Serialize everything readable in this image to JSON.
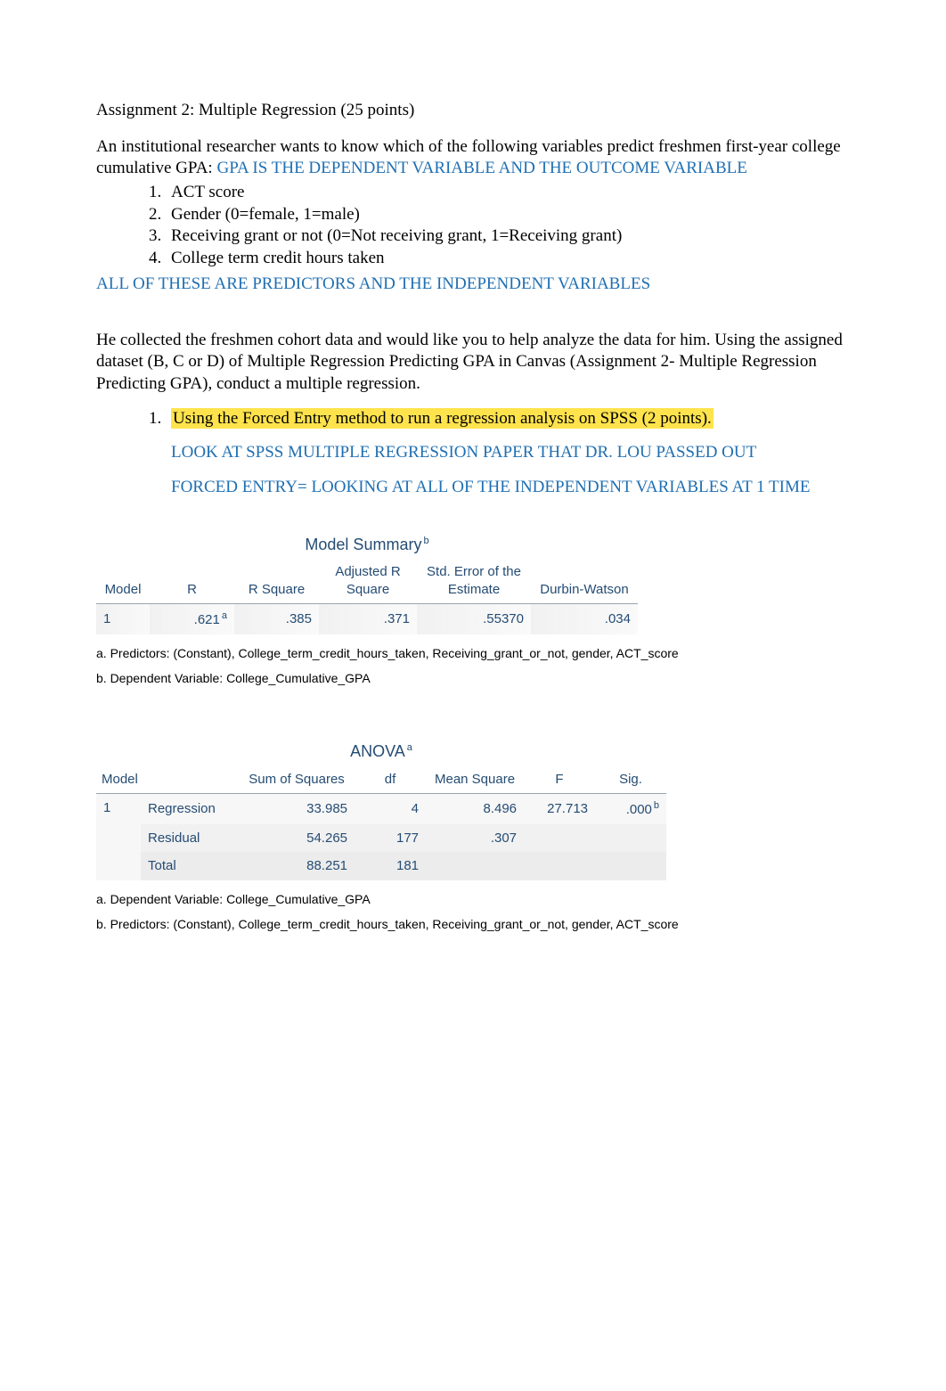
{
  "header": {
    "title": "Assignment 2: Multiple Regression (25 points)"
  },
  "intro": {
    "line1": "An institutional researcher wants to know which of the following variables predict freshmen first-year college cumulative GPA:  ",
    "dep_note": "GPA IS THE DEPENDENT VARIABLE AND THE OUTCOME VARIABLE",
    "items": {
      "i1": "ACT score",
      "i2": "Gender (0=female, 1=male)",
      "i3": "Receiving grant or not (0=Not receiving grant, 1=Receiving grant)",
      "i4": "College term credit hours taken"
    },
    "all_predictors": "ALL OF THESE ARE PREDICTORS AND THE INDEPENDENT VARIABLES"
  },
  "collected": "He collected the freshmen cohort data and would like you to help analyze the data for him. Using the assigned dataset (B, C or D) of Multiple Regression Predicting GPA in Canvas (Assignment 2- Multiple Regression Predicting GPA), conduct a multiple regression.",
  "step1": {
    "highlight": "Using the Forced Entry method to run a regression analysis on SPSS (2 points).",
    "note1": "LOOK AT SPSS MULTIPLE REGRESSION PAPER THAT DR. LOU PASSED OUT",
    "note2": "FORCED ENTRY= LOOKING AT ALL OF THE INDEPENDENT VARIABLES AT 1 TIME"
  },
  "model_summary": {
    "title": "Model Summary",
    "sup": "b",
    "headers": {
      "model": "Model",
      "r": "R",
      "rsq": "R Square",
      "arsq_top": "Adjusted R",
      "arsq_bot": "Square",
      "se_top": "Std. Error of the",
      "se_bot": "Estimate",
      "dw": "Durbin-Watson"
    },
    "row": {
      "model": "1",
      "r": ".621",
      "r_sup": "a",
      "rsq": ".385",
      "arsq": ".371",
      "se": ".55370",
      "dw": ".034"
    },
    "foot_a": "a. Predictors: (Constant), College_term_credit_hours_taken, Receiving_grant_or_not, gender, ACT_score",
    "foot_b": "b. Dependent Variable: College_Cumulative_GPA"
  },
  "anova": {
    "title": "ANOVA",
    "sup": "a",
    "headers": {
      "model": "Model",
      "ss": "Sum of Squares",
      "df": "df",
      "ms": "Mean Square",
      "f": "F",
      "sig": "Sig."
    },
    "rows": {
      "model_num": "1",
      "reg": {
        "label": "Regression",
        "ss": "33.985",
        "df": "4",
        "ms": "8.496",
        "f": "27.713",
        "sig": ".000",
        "sig_sup": "b"
      },
      "res": {
        "label": "Residual",
        "ss": "54.265",
        "df": "177",
        "ms": ".307",
        "f": "",
        "sig": ""
      },
      "tot": {
        "label": "Total",
        "ss": "88.251",
        "df": "181",
        "ms": "",
        "f": "",
        "sig": ""
      }
    },
    "foot_a": "a. Dependent Variable: College_Cumulative_GPA",
    "foot_b": "b. Predictors: (Constant), College_term_credit_hours_taken, Receiving_grant_or_not, gender, ACT_score"
  }
}
